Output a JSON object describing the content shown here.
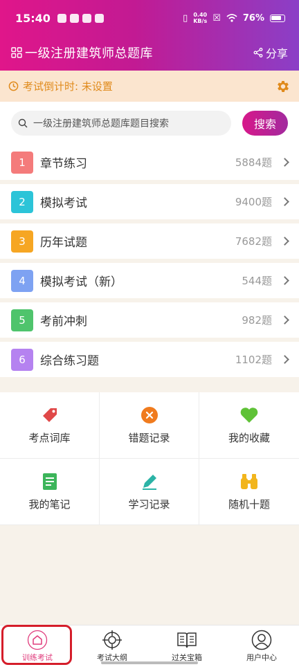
{
  "status_bar": {
    "time": "15:40",
    "network_speed_value": "0.40",
    "network_speed_unit": "KB/s",
    "battery": "76%"
  },
  "app_bar": {
    "title": "一级注册建筑师总题库",
    "share_label": "分享"
  },
  "countdown": {
    "text": "考试倒计时: 未设置"
  },
  "search": {
    "placeholder": "一级注册建筑师总题库题目搜索",
    "button_label": "搜索"
  },
  "sections": [
    {
      "number": "1",
      "label": "章节练习",
      "count": "5884题",
      "color": "#f47b7b"
    },
    {
      "number": "2",
      "label": "模拟考试",
      "count": "9400题",
      "color": "#2cc4d8"
    },
    {
      "number": "3",
      "label": "历年试题",
      "count": "7682题",
      "color": "#f6a623"
    },
    {
      "number": "4",
      "label": "模拟考试（新）",
      "count": "544题",
      "color": "#7ea2f2"
    },
    {
      "number": "5",
      "label": "考前冲刺",
      "count": "982题",
      "color": "#4fc46c"
    },
    {
      "number": "6",
      "label": "综合练习题",
      "count": "1102题",
      "color": "#b582f0"
    }
  ],
  "tools": [
    {
      "label": "考点词库",
      "icon": "tag-icon",
      "color": "#e04848"
    },
    {
      "label": "错题记录",
      "icon": "error-x-icon",
      "color": "#f07b1e"
    },
    {
      "label": "我的收藏",
      "icon": "heart-icon",
      "color": "#5fc237"
    },
    {
      "label": "我的笔记",
      "icon": "notebook-icon",
      "color": "#3cb55a"
    },
    {
      "label": "学习记录",
      "icon": "pencil-icon",
      "color": "#2bb3a6"
    },
    {
      "label": "随机十题",
      "icon": "binoculars-icon",
      "color": "#f2b51c"
    }
  ],
  "tab_bar": [
    {
      "label": "训练考试",
      "icon": "home-icon",
      "active": true
    },
    {
      "label": "考试大纲",
      "icon": "target-icon",
      "active": false
    },
    {
      "label": "过关宝箱",
      "icon": "book-icon",
      "active": false
    },
    {
      "label": "用户中心",
      "icon": "user-icon",
      "active": false
    }
  ],
  "colors": {
    "brand_gradient_start": "#e0168a",
    "brand_gradient_end": "#8b3fc7",
    "countdown_text": "#e08a1b",
    "countdown_bg": "#fbe5cf",
    "active_tab": "#e03c7c",
    "annotation_box": "#d51d2a"
  }
}
